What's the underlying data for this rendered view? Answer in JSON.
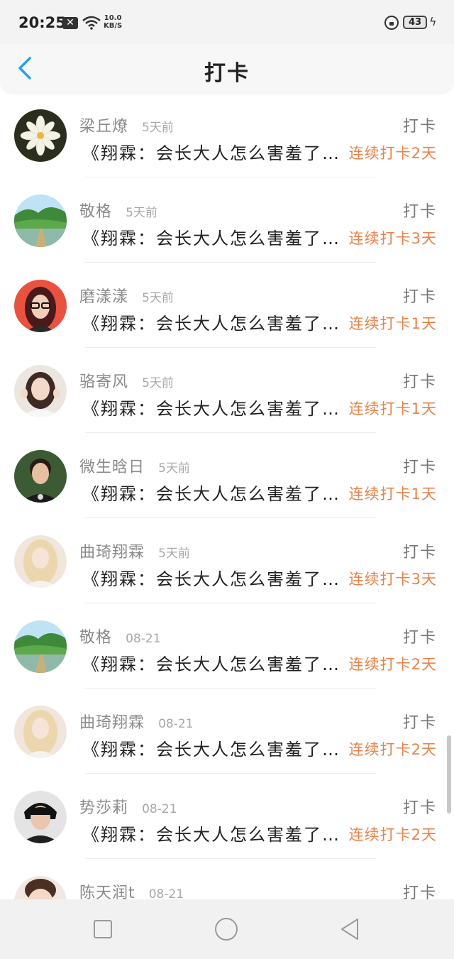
{
  "status_bar": {
    "time": "20:25",
    "notification_badge": "✕",
    "net_speed_value": "10.0",
    "net_speed_unit": "KB/S",
    "battery": "43"
  },
  "header": {
    "title": "打卡"
  },
  "colors": {
    "accent_blue": "#2a9df4",
    "streak_orange": "#e8834a"
  },
  "checkins": [
    {
      "name": "梁丘燎",
      "time": "5天前",
      "action": "打卡",
      "book": "《翔霖：会长大人怎么害羞了…",
      "streak": "连续打卡2天",
      "avatar": "flower"
    },
    {
      "name": "敬格",
      "time": "5天前",
      "action": "打卡",
      "book": "《翔霖：会长大人怎么害羞了…",
      "streak": "连续打卡3天",
      "avatar": "landscape"
    },
    {
      "name": "磨漾漾",
      "time": "5天前",
      "action": "打卡",
      "book": "《翔霖：会长大人怎么害羞了…",
      "streak": "连续打卡1天",
      "avatar": "woman-red"
    },
    {
      "name": "骆寄风",
      "time": "5天前",
      "action": "打卡",
      "book": "《翔霖：会长大人怎么害羞了…",
      "streak": "连续打卡1天",
      "avatar": "girl"
    },
    {
      "name": "微生晗日",
      "time": "5天前",
      "action": "打卡",
      "book": "《翔霖：会长大人怎么害羞了…",
      "streak": "连续打卡1天",
      "avatar": "man"
    },
    {
      "name": "曲琦翔霖",
      "time": "5天前",
      "action": "打卡",
      "book": "《翔霖：会长大人怎么害羞了…",
      "streak": "连续打卡3天",
      "avatar": "blonde"
    },
    {
      "name": "敬格",
      "time": "08-21",
      "action": "打卡",
      "book": "《翔霖：会长大人怎么害羞了…",
      "streak": "连续打卡2天",
      "avatar": "landscape"
    },
    {
      "name": "曲琦翔霖",
      "time": "08-21",
      "action": "打卡",
      "book": "《翔霖：会长大人怎么害羞了…",
      "streak": "连续打卡2天",
      "avatar": "blonde"
    },
    {
      "name": "势莎莉",
      "time": "08-21",
      "action": "打卡",
      "book": "《翔霖：会长大人怎么害羞了…",
      "streak": "连续打卡2天",
      "avatar": "boy"
    },
    {
      "name": "陈天润t",
      "time": "08-21",
      "action": "打卡",
      "book": "",
      "streak": "",
      "avatar": "child"
    }
  ],
  "nav": {
    "recent_icon": "square-icon",
    "home_icon": "circle-icon",
    "back_icon": "triangle-icon"
  }
}
